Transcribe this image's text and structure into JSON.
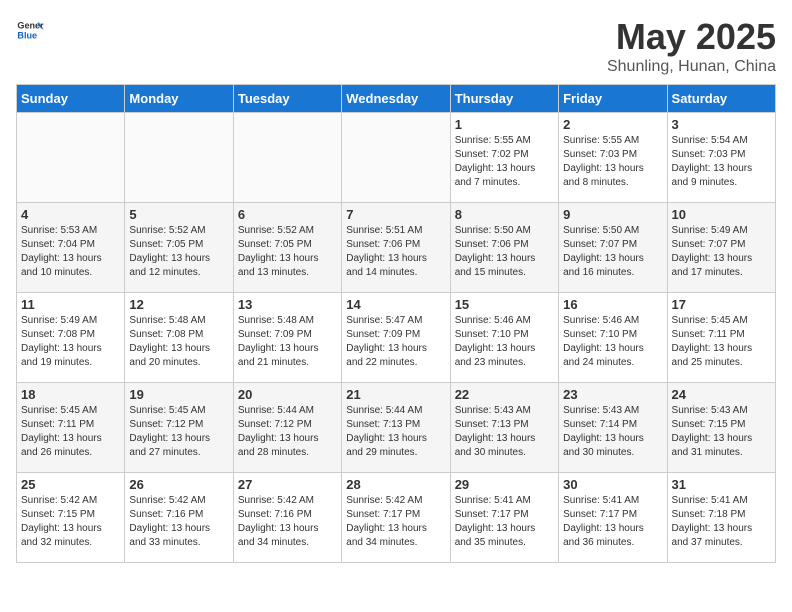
{
  "header": {
    "logo_general": "General",
    "logo_blue": "Blue",
    "title": "May 2025",
    "subtitle": "Shunling, Hunan, China"
  },
  "days_of_week": [
    "Sunday",
    "Monday",
    "Tuesday",
    "Wednesday",
    "Thursday",
    "Friday",
    "Saturday"
  ],
  "weeks": [
    [
      {
        "day": "",
        "info": ""
      },
      {
        "day": "",
        "info": ""
      },
      {
        "day": "",
        "info": ""
      },
      {
        "day": "",
        "info": ""
      },
      {
        "day": "1",
        "info": "Sunrise: 5:55 AM\nSunset: 7:02 PM\nDaylight: 13 hours\nand 7 minutes."
      },
      {
        "day": "2",
        "info": "Sunrise: 5:55 AM\nSunset: 7:03 PM\nDaylight: 13 hours\nand 8 minutes."
      },
      {
        "day": "3",
        "info": "Sunrise: 5:54 AM\nSunset: 7:03 PM\nDaylight: 13 hours\nand 9 minutes."
      }
    ],
    [
      {
        "day": "4",
        "info": "Sunrise: 5:53 AM\nSunset: 7:04 PM\nDaylight: 13 hours\nand 10 minutes."
      },
      {
        "day": "5",
        "info": "Sunrise: 5:52 AM\nSunset: 7:05 PM\nDaylight: 13 hours\nand 12 minutes."
      },
      {
        "day": "6",
        "info": "Sunrise: 5:52 AM\nSunset: 7:05 PM\nDaylight: 13 hours\nand 13 minutes."
      },
      {
        "day": "7",
        "info": "Sunrise: 5:51 AM\nSunset: 7:06 PM\nDaylight: 13 hours\nand 14 minutes."
      },
      {
        "day": "8",
        "info": "Sunrise: 5:50 AM\nSunset: 7:06 PM\nDaylight: 13 hours\nand 15 minutes."
      },
      {
        "day": "9",
        "info": "Sunrise: 5:50 AM\nSunset: 7:07 PM\nDaylight: 13 hours\nand 16 minutes."
      },
      {
        "day": "10",
        "info": "Sunrise: 5:49 AM\nSunset: 7:07 PM\nDaylight: 13 hours\nand 17 minutes."
      }
    ],
    [
      {
        "day": "11",
        "info": "Sunrise: 5:49 AM\nSunset: 7:08 PM\nDaylight: 13 hours\nand 19 minutes."
      },
      {
        "day": "12",
        "info": "Sunrise: 5:48 AM\nSunset: 7:08 PM\nDaylight: 13 hours\nand 20 minutes."
      },
      {
        "day": "13",
        "info": "Sunrise: 5:48 AM\nSunset: 7:09 PM\nDaylight: 13 hours\nand 21 minutes."
      },
      {
        "day": "14",
        "info": "Sunrise: 5:47 AM\nSunset: 7:09 PM\nDaylight: 13 hours\nand 22 minutes."
      },
      {
        "day": "15",
        "info": "Sunrise: 5:46 AM\nSunset: 7:10 PM\nDaylight: 13 hours\nand 23 minutes."
      },
      {
        "day": "16",
        "info": "Sunrise: 5:46 AM\nSunset: 7:10 PM\nDaylight: 13 hours\nand 24 minutes."
      },
      {
        "day": "17",
        "info": "Sunrise: 5:45 AM\nSunset: 7:11 PM\nDaylight: 13 hours\nand 25 minutes."
      }
    ],
    [
      {
        "day": "18",
        "info": "Sunrise: 5:45 AM\nSunset: 7:11 PM\nDaylight: 13 hours\nand 26 minutes."
      },
      {
        "day": "19",
        "info": "Sunrise: 5:45 AM\nSunset: 7:12 PM\nDaylight: 13 hours\nand 27 minutes."
      },
      {
        "day": "20",
        "info": "Sunrise: 5:44 AM\nSunset: 7:12 PM\nDaylight: 13 hours\nand 28 minutes."
      },
      {
        "day": "21",
        "info": "Sunrise: 5:44 AM\nSunset: 7:13 PM\nDaylight: 13 hours\nand 29 minutes."
      },
      {
        "day": "22",
        "info": "Sunrise: 5:43 AM\nSunset: 7:13 PM\nDaylight: 13 hours\nand 30 minutes."
      },
      {
        "day": "23",
        "info": "Sunrise: 5:43 AM\nSunset: 7:14 PM\nDaylight: 13 hours\nand 30 minutes."
      },
      {
        "day": "24",
        "info": "Sunrise: 5:43 AM\nSunset: 7:15 PM\nDaylight: 13 hours\nand 31 minutes."
      }
    ],
    [
      {
        "day": "25",
        "info": "Sunrise: 5:42 AM\nSunset: 7:15 PM\nDaylight: 13 hours\nand 32 minutes."
      },
      {
        "day": "26",
        "info": "Sunrise: 5:42 AM\nSunset: 7:16 PM\nDaylight: 13 hours\nand 33 minutes."
      },
      {
        "day": "27",
        "info": "Sunrise: 5:42 AM\nSunset: 7:16 PM\nDaylight: 13 hours\nand 34 minutes."
      },
      {
        "day": "28",
        "info": "Sunrise: 5:42 AM\nSunset: 7:17 PM\nDaylight: 13 hours\nand 34 minutes."
      },
      {
        "day": "29",
        "info": "Sunrise: 5:41 AM\nSunset: 7:17 PM\nDaylight: 13 hours\nand 35 minutes."
      },
      {
        "day": "30",
        "info": "Sunrise: 5:41 AM\nSunset: 7:17 PM\nDaylight: 13 hours\nand 36 minutes."
      },
      {
        "day": "31",
        "info": "Sunrise: 5:41 AM\nSunset: 7:18 PM\nDaylight: 13 hours\nand 37 minutes."
      }
    ]
  ]
}
